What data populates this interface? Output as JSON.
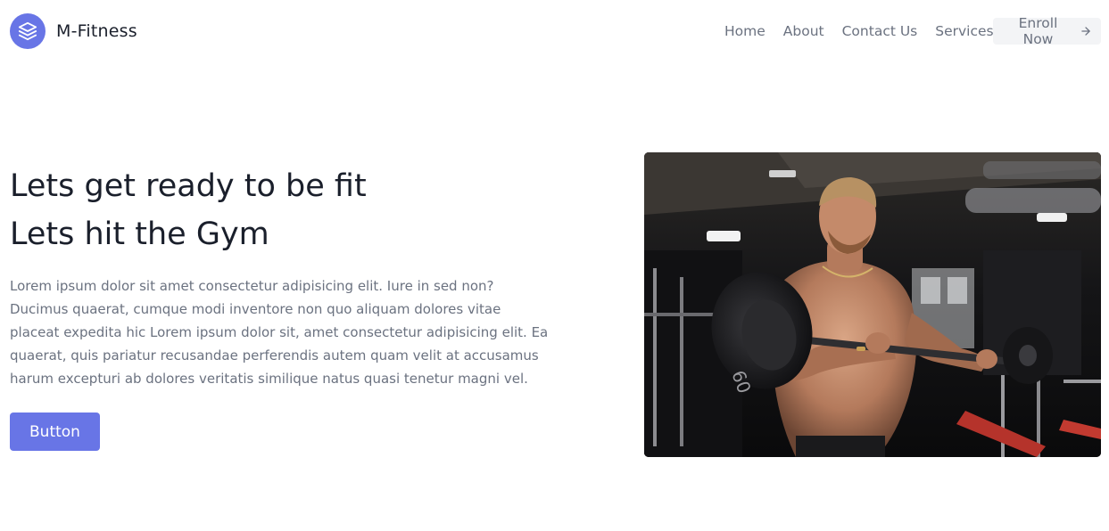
{
  "brand": {
    "name": "M-Fitness",
    "logo_icon": "layers-icon",
    "accent_color": "#6875e6"
  },
  "nav": {
    "items": [
      {
        "label": "Home"
      },
      {
        "label": "About"
      },
      {
        "label": "Contact Us"
      },
      {
        "label": "Services"
      }
    ],
    "enroll_label": "Enroll Now",
    "enroll_icon": "arrow-right-icon"
  },
  "hero": {
    "title_line1": "Lets get ready to be fit",
    "title_line2": "Lets hit the Gym",
    "description": "Lorem ipsum dolor sit amet consectetur adipisicing elit. Iure in sed non? Ducimus quaerat, cumque modi inventore non quo aliquam dolores vitae placeat expedita hic Lorem ipsum dolor sit, amet consectetur adipisicing elit. Ea quaerat, quis pariatur recusandae perferendis autem quam velit at accusamus harum excepturi ab dolores veritatis similique natus quasi tenetur magni vel.",
    "button_label": "Button",
    "image_plate_label": "60"
  }
}
